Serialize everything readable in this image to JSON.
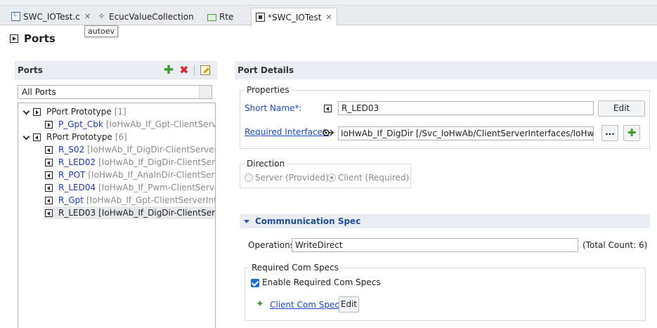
{
  "tabs": [
    {
      "label": "SWC_IOTest.c",
      "icon": "c-file-icon",
      "closable": true,
      "active": false
    },
    {
      "label": "EcucValueCollection",
      "icon": "ecuc-icon",
      "closable": false,
      "active": false
    },
    {
      "label": "Rte",
      "icon": "rte-icon",
      "closable": false,
      "active": false
    },
    {
      "label": "*SWC_IOTest",
      "icon": "swc-icon",
      "closable": true,
      "active": true
    }
  ],
  "tooltip": "autoev",
  "page": {
    "title": "Ports"
  },
  "ports_panel": {
    "title": "Ports",
    "filter_value": "All Ports",
    "groups": [
      {
        "label": "PPort Prototype",
        "count": "[1]",
        "items": [
          {
            "name": "P_Gpt_Cbk",
            "type": "[IoHwAb_If_Gpt-ClientServerI"
          }
        ]
      },
      {
        "label": "RPort Prototype",
        "count": "[6]",
        "items": [
          {
            "name": "R_S02",
            "type": "[IoHwAb_If_DigDir-ClientServerInt"
          },
          {
            "name": "R_LED02",
            "type": "[IoHwAb_If_DigDir-ClientServer"
          },
          {
            "name": "R_POT",
            "type": "[IoHwAb_If_AnaInDir-ClientServer"
          },
          {
            "name": "R_LED04",
            "type": "[IoHwAb_If_Pwm-ClientServerIn"
          },
          {
            "name": "R_Gpt",
            "type": "[IoHwAb_If_Gpt-ClientServerInterfa"
          },
          {
            "name": "R_LED03",
            "type": "[IoHwAb_If_DigDir-ClientServer"
          }
        ]
      }
    ]
  },
  "details": {
    "title": "Port Details",
    "properties_label": "Properties",
    "short_name_label": "Short Name*:",
    "short_name_value": "R_LED03",
    "edit_label": "Edit",
    "required_interface_label": "Required Interface*:",
    "required_interface_value": "IoHwAb_If_DigDir [/Svc_IoHwAb/ClientServerInterfaces/IoHwAb_If_",
    "browse_label": "...",
    "direction_label": "Direction",
    "server_label": "Server (Provided)",
    "client_label": "Client (Required)",
    "comm_spec_title": "Commnunication Spec",
    "operations_label": "Operations",
    "operations_value": "WriteDirect",
    "total_count": "(Total Count: 6)",
    "required_com_specs_label": "Required Com Specs",
    "enable_label": "Enable Required Com Specs",
    "client_com_spec_label": "Client Com Spec",
    "client_com_spec_edit": "Edit"
  },
  "colors": {
    "link": "#1a49c7",
    "accent": "#1f6fd1",
    "add_green": "#3a9b2a",
    "delete_red": "#d12d2d"
  }
}
